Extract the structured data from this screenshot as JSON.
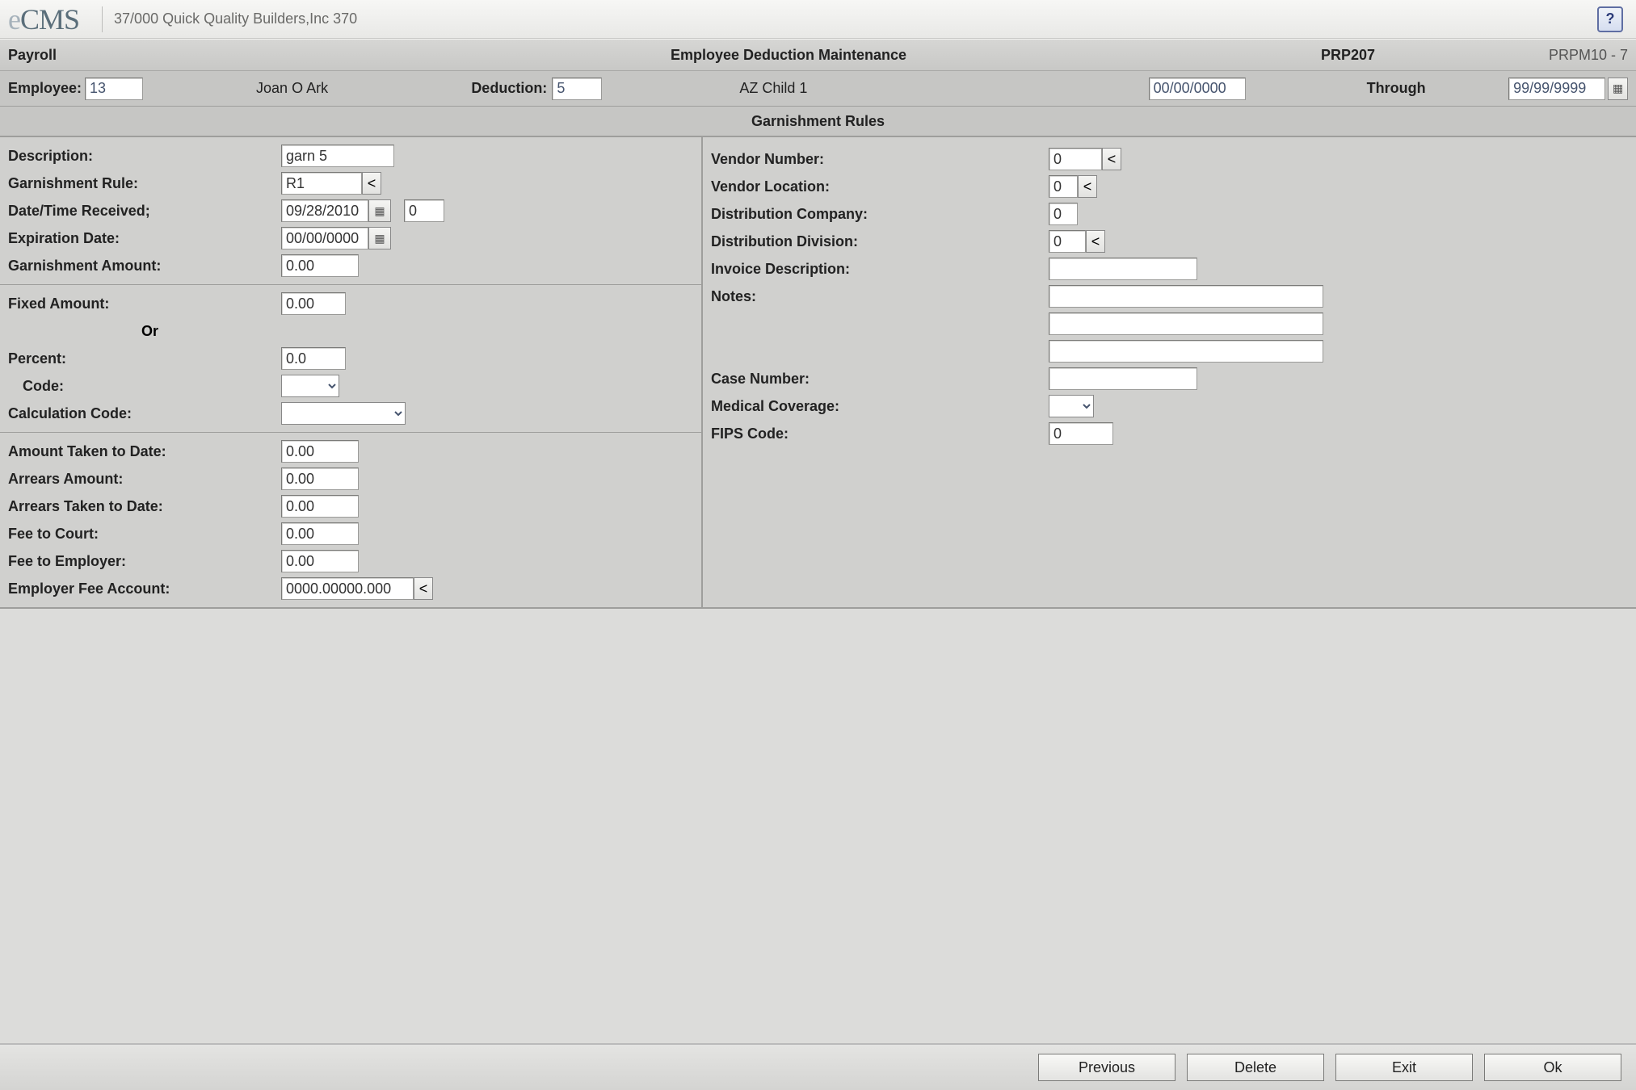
{
  "app": {
    "logo_e": "e",
    "logo_rest": "CMS",
    "company": "37/000  Quick Quality Builders,Inc 370",
    "help_glyph": "?"
  },
  "titlebar": {
    "module": "Payroll",
    "title": "Employee Deduction Maintenance",
    "code": "PRP207",
    "ref": "PRPM10 - 7"
  },
  "header": {
    "employee_label": "Employee:",
    "employee_value": "13",
    "employee_name": "Joan O Ark",
    "deduction_label": "Deduction:",
    "deduction_value": "5",
    "deduction_name": "AZ Child 1",
    "date_from": "00/00/0000",
    "through_label": "Through",
    "date_to": "99/99/9999"
  },
  "section_title": "Garnishment Rules",
  "left": {
    "description_label": "Description:",
    "description_value": "garn 5",
    "garn_rule_label": "Garnishment Rule:",
    "garn_rule_value": "R1",
    "date_time_received_label": "Date/Time Received;",
    "date_time_received_value": "09/28/2010",
    "date_time_received_time": "0",
    "expiration_date_label": "Expiration Date:",
    "expiration_date_value": "00/00/0000",
    "garn_amount_label": "Garnishment Amount:",
    "garn_amount_value": "0.00",
    "fixed_amount_label": "Fixed Amount:",
    "fixed_amount_value": "0.00",
    "or_label": "Or",
    "percent_label": "Percent:",
    "percent_value": "0.0",
    "code_label": "Code:",
    "calc_code_label": "Calculation Code:",
    "amount_taken_label": "Amount Taken to Date:",
    "amount_taken_value": "0.00",
    "arrears_amount_label": "Arrears Amount:",
    "arrears_amount_value": "0.00",
    "arrears_taken_label": "Arrears Taken to Date:",
    "arrears_taken_value": "0.00",
    "fee_court_label": "Fee to Court:",
    "fee_court_value": "0.00",
    "fee_employer_label": "Fee to Employer:",
    "fee_employer_value": "0.00",
    "emp_fee_account_label": "Employer Fee Account:",
    "emp_fee_account_value": "0000.00000.000"
  },
  "right": {
    "vendor_number_label": "Vendor Number:",
    "vendor_number_value": "0",
    "vendor_location_label": "Vendor Location:",
    "vendor_location_value": "0",
    "dist_company_label": "Distribution Company:",
    "dist_company_value": "0",
    "dist_division_label": "Distribution Division:",
    "dist_division_value": "0",
    "invoice_desc_label": "Invoice Description:",
    "invoice_desc_value": "",
    "notes_label": "Notes:",
    "notes1": "",
    "notes2": "",
    "notes3": "",
    "case_number_label": "Case Number:",
    "case_number_value": "",
    "medical_coverage_label": "Medical Coverage:",
    "fips_code_label": "FIPS Code:",
    "fips_code_value": "0"
  },
  "footer": {
    "previous": "Previous",
    "delete": "Delete",
    "exit": "Exit",
    "ok": "Ok"
  },
  "glyphs": {
    "lookup": "<",
    "calendar": "▦"
  }
}
